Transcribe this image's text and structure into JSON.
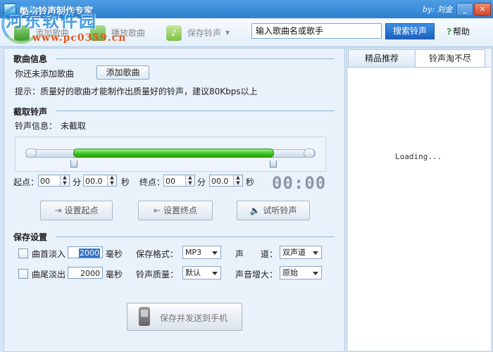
{
  "window": {
    "title": "酷狗铃声制作专家",
    "author": "by: 刘金",
    "controls": [
      "_",
      "×"
    ],
    "watermark": "河东软件园",
    "watermark_url": "www.pc0359.cn"
  },
  "toolbar": {
    "add_song": "添加歌曲",
    "play_song": "播放歌曲",
    "save_ringtone": "保存铃声",
    "search_value": "输入歌曲名或歌手",
    "search_button": "搜索铃声",
    "help": "帮助"
  },
  "song_info": {
    "title": "歌曲信息",
    "status": "你还未添加歌曲",
    "add_button": "添加歌曲",
    "tip": "提示：质量好的歌曲才能制作出质量好的铃声，建议80Kbps以上"
  },
  "clip": {
    "title": "截取铃声",
    "info_label": "铃声信息：",
    "info_value": "未截取",
    "start_label": "起点：",
    "end_label": "终点：",
    "start_min": "00",
    "start_sec": "00.0",
    "end_min": "00",
    "end_sec": "00.0",
    "min_unit": "分",
    "sec_unit": "秒",
    "timer": "00:00",
    "set_start": "设置起点",
    "set_end": "设置终点",
    "preview": "试听铃声"
  },
  "save_settings": {
    "title": "保存设置",
    "fade_in_label": "曲首淡入",
    "fade_in_value": "2000",
    "fade_out_label": "曲尾淡出",
    "fade_out_value": "2000",
    "ms_unit": "毫秒",
    "format_label": "保存格式：",
    "format_value": "MP3",
    "quality_label": "铃声质量：",
    "quality_value": "默认",
    "channel_label": "声　　道：",
    "channel_value": "双声道",
    "volume_label": "声音增大：",
    "volume_value": "原始",
    "send_button": "保存并发送到手机"
  },
  "right_panel": {
    "tabs": [
      "精品推荐",
      "铃声淘不尽"
    ],
    "loading": "Loading..."
  }
}
